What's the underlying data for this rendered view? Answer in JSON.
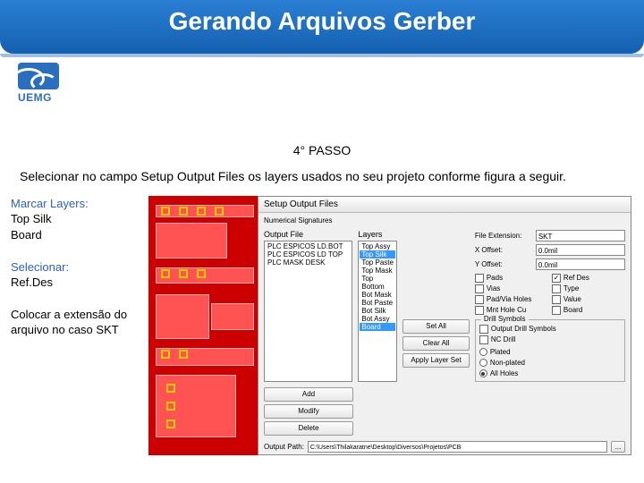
{
  "slide": {
    "title": "Gerando Arquivos Gerber",
    "logo_text": "UEMG",
    "step": "4° PASSO",
    "description": "Selecionar no campo Setup Output Files os layers usados no seu projeto conforme figura a seguir."
  },
  "sidebar": {
    "marcar_label": "Marcar Layers:",
    "marcar_items": [
      "Top Silk",
      "Board"
    ],
    "selecionar_label": "Selecionar:",
    "selecionar_items": [
      "Ref.Des"
    ],
    "extensao": "Colocar a extensão do arquivo no caso SKT"
  },
  "dialog": {
    "title": "Setup Output Files",
    "sections": {
      "output_file": "Output File",
      "layers": "Layers"
    },
    "output_files": [
      "PLC ESPICOS LD.BOT",
      "PLC ESPICOS LD TOP",
      "PLC MASK DESK"
    ],
    "layers": [
      "Top Assy",
      "Top Silk",
      "Top Paste",
      "Top Mask",
      "Top",
      "Bottom",
      "Bot Mask",
      "Bot Paste",
      "Bot Silk",
      "Bot Assy",
      "Board"
    ],
    "layers_selected": [
      "Top Silk",
      "Board"
    ],
    "fields": {
      "file_ext_label": "File Extension:",
      "file_ext": "SKT",
      "x_offset_label": "X Offset:",
      "x_offset": "0.0mil",
      "y_offset_label": "Y Offset:",
      "y_offset": "0.0mil"
    },
    "checks_left": [
      {
        "label": "Pads",
        "checked": false
      },
      {
        "label": "Vias",
        "checked": false
      },
      {
        "label": "Pad/Via Holes",
        "checked": false
      },
      {
        "label": "Mnt Hole Cu",
        "checked": false
      }
    ],
    "checks_right": [
      {
        "label": "Ref Des",
        "checked": true
      },
      {
        "label": "Type",
        "checked": false
      },
      {
        "label": "Value",
        "checked": false
      },
      {
        "label": "Board",
        "checked": false
      }
    ],
    "drill_group": "Drill Symbols",
    "drill_checks": [
      {
        "label": "Output Drill Symbols",
        "checked": false
      },
      {
        "label": "NC Drill",
        "checked": false
      }
    ],
    "drill_radios": [
      {
        "label": "Plated",
        "checked": false
      },
      {
        "label": "Non-plated",
        "checked": false
      },
      {
        "label": "All Holes",
        "checked": true
      }
    ],
    "mid_buttons": [
      "Set All",
      "Clear All",
      "Apply Layer Set"
    ],
    "left_buttons": [
      "Add",
      "Modify",
      "Delete"
    ],
    "output_path_label": "Output Path:",
    "output_path": "C:\\Users\\Thilakaratne\\Desktop\\Diversos\\Projetos\\PCB",
    "browse": "..."
  }
}
